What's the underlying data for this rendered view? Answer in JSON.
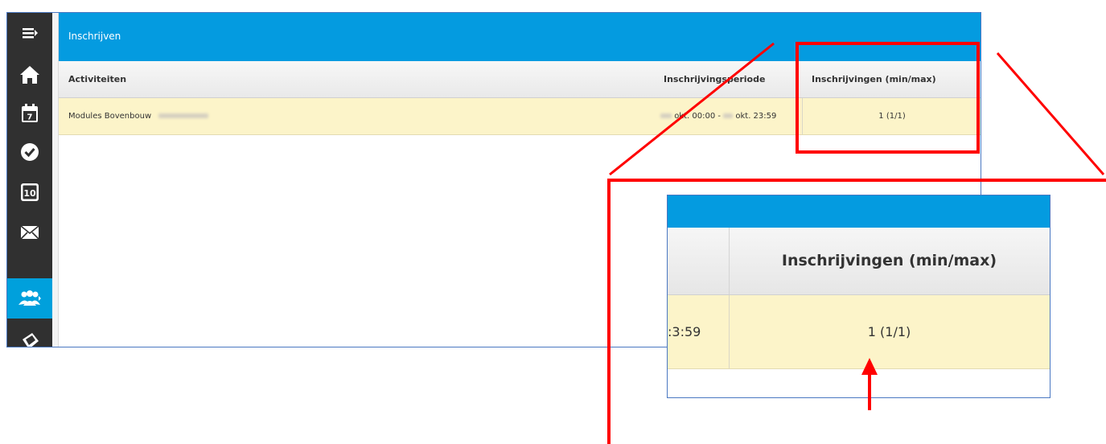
{
  "header": {
    "title": "Inschrijven"
  },
  "table": {
    "columns": [
      "Activiteiten",
      "Inschrijvingsperiode",
      "Inschrijvingen (min/max)"
    ],
    "rows": [
      {
        "activity": "Modules Bovenbouw",
        "period_start": "okt. 00:00 -",
        "period_end": "okt. 23:59",
        "enrollments": "1 (1/1)"
      }
    ]
  },
  "zoom": {
    "column_header": "Inschrijvingen (min/max)",
    "cut_text": ":3:59",
    "value": "1 (1/1)"
  },
  "sidebar": {
    "items": [
      "menu-toggle",
      "home",
      "calendar",
      "tasks",
      "grades",
      "messages",
      "groups",
      "assignments"
    ]
  },
  "colors": {
    "accent": "#049be0",
    "sidebar": "#303030",
    "highlight_row": "#fcf4c9",
    "annotation": "#ff0000"
  }
}
